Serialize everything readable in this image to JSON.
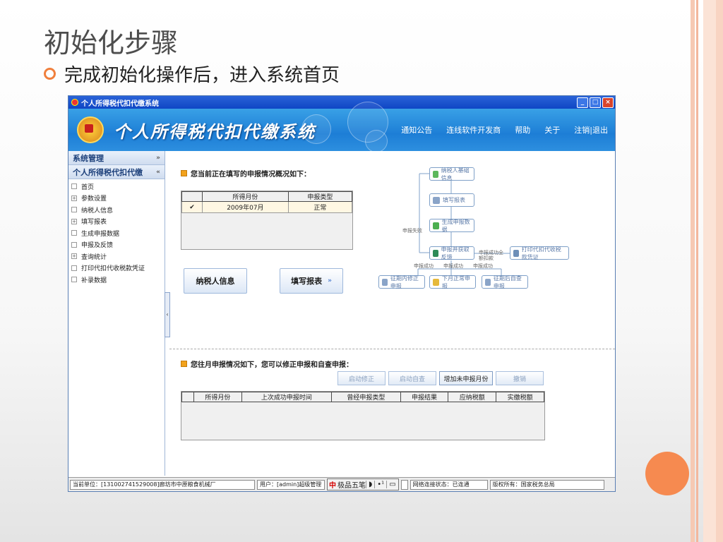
{
  "slide": {
    "title": "初始化步骤",
    "bullet": "完成初始化操作后，进入系统首页"
  },
  "window": {
    "title": "个人所得税代扣代缴系统",
    "controls": [
      "_",
      "□",
      "×"
    ]
  },
  "banner": {
    "title": "个人所得税代扣代缴系统",
    "nav": [
      "通知公告",
      "连线软件开发商",
      "帮助",
      "关于",
      "注销|退出"
    ]
  },
  "sidebar": {
    "sections": [
      "系统管理",
      "个人所得税代扣代缴"
    ],
    "items": [
      {
        "label": "首页",
        "mark": ""
      },
      {
        "label": "参数设置",
        "mark": "+"
      },
      {
        "label": "纳税人信息",
        "mark": ""
      },
      {
        "label": "填写报表",
        "mark": "+"
      },
      {
        "label": "生成申报数据",
        "mark": ""
      },
      {
        "label": "申报及反馈",
        "mark": ""
      },
      {
        "label": "查询统计",
        "mark": "+"
      },
      {
        "label": "打印代扣代收税款凭证",
        "mark": ""
      },
      {
        "label": "补录数据",
        "mark": ""
      }
    ]
  },
  "current": {
    "heading": "您当前正在填写的申报情况概况如下：",
    "columns": [
      "所得月份",
      "申报类型"
    ],
    "rows": [
      {
        "month": "2009年07月",
        "type": "正常"
      }
    ],
    "btn_taxpayer": "纳税人信息",
    "btn_fill": "填写报表"
  },
  "flow": {
    "n1": "纳税人基础信息",
    "n2": "填写报表",
    "n3": "生成申报数据",
    "n4": "申报并获取反馈",
    "n5": "打印代扣代收税款凭证",
    "n6": "征期内修正申报",
    "n7": "下月正常申报",
    "n8": "征期后自查申报",
    "l_fail": "申报失败",
    "l_success_all": "申报成功全额扣款",
    "l_s1": "申报成功",
    "l_s2": "申报成功",
    "l_s3": "申报成功"
  },
  "history": {
    "heading": "您往月申报情况如下，您可以修正申报和自查申报：",
    "btn_correct": "启动修正",
    "btn_self": "启动自查",
    "btn_add": "增加未申报月份",
    "btn_cancel": "撤销",
    "columns": [
      "所得月份",
      "上次成功申报时间",
      "曾经申报类型",
      "申报结果",
      "应纳税额",
      "实缴税额"
    ]
  },
  "status": {
    "unit": "当前单位：[131002741529008]廊坊市中原粮食机械厂",
    "user": "用户：[admin]超级管理",
    "ime_name": "极品五笔",
    "network": "网络连接状态：已连通",
    "copyright": "版权所有：国家税务总局"
  }
}
